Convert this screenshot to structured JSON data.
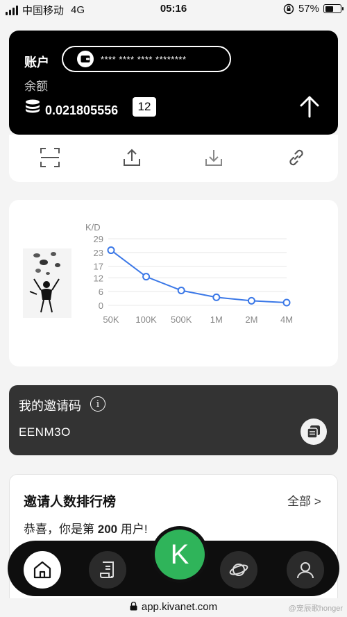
{
  "status_bar": {
    "carrier": "中国移动",
    "network": "4G",
    "time": "05:16",
    "battery": "57%",
    "battery_level": 0.57
  },
  "account": {
    "title": "账户",
    "masked_number": "**** **** **** ********",
    "balance_label": "余额",
    "balance_value": "0.021805556",
    "badge": "12"
  },
  "actions": [
    "scan-icon",
    "upload-icon",
    "download-icon",
    "link-icon"
  ],
  "chart_data": {
    "type": "line",
    "ylabel": "K/D",
    "categories": [
      "50K",
      "100K",
      "500K",
      "1M",
      "2M",
      "4M"
    ],
    "values": [
      24,
      12.5,
      6.5,
      3.5,
      2,
      1.2
    ],
    "yticks": [
      29,
      23,
      17,
      12,
      6,
      0
    ],
    "ylim": [
      0,
      29
    ],
    "grid": true,
    "color": "#3b78e7"
  },
  "invite": {
    "title": "我的邀请码",
    "info_glyph": "i",
    "code": "EENM3O"
  },
  "ranking": {
    "title": "邀请人数排行榜",
    "all_link": "全部 >",
    "congrats_prefix": "恭喜，你是第",
    "rank_number": "200",
    "congrats_suffix": "用户!"
  },
  "nav": {
    "items": [
      "home-icon",
      "scroll-icon",
      "planet-icon",
      "profile-icon"
    ],
    "center_label": "K",
    "active_color": "#2fb45a"
  },
  "url_bar": {
    "url": "app.kivanet.com"
  },
  "watermark": "@宠辰歌honger"
}
